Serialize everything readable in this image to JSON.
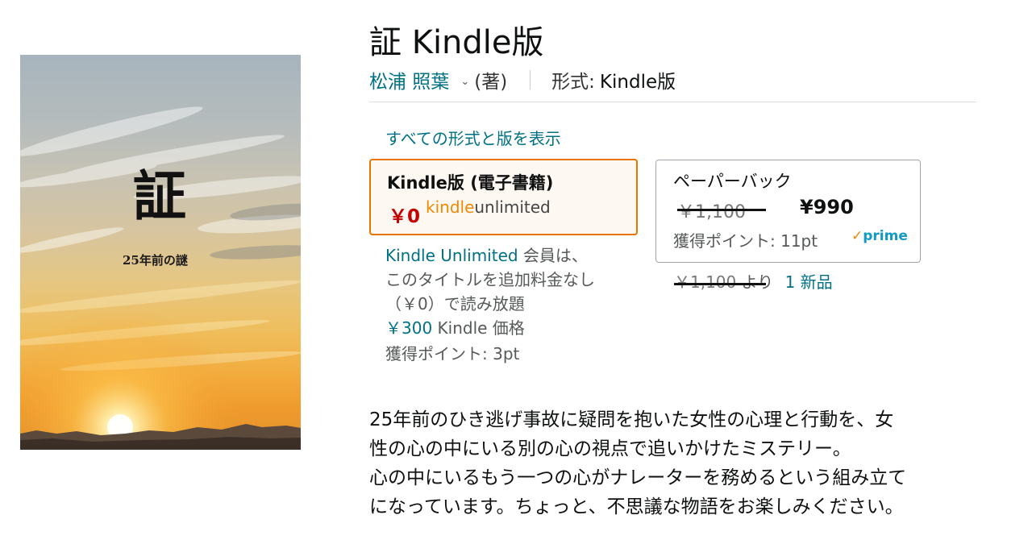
{
  "cover": {
    "title": "証",
    "subtitle": "25年前の謎"
  },
  "product": {
    "title": "証 Kindle版",
    "author": "松浦 照葉",
    "contribution": "(著)",
    "format_label": "形式:",
    "format_value": "Kindle版",
    "all_formats_link": "すべての形式と版を表示"
  },
  "formats": {
    "kindle": {
      "name": "Kindle版 (電子書籍)",
      "price": "￥0",
      "ku_logo_kindle": "kindle",
      "ku_logo_unlimited": "unlimited"
    },
    "paperback": {
      "name": "ペーパーバック",
      "list_price": "￥1,100",
      "sale_price": "¥990",
      "points": "獲得ポイント: 11pt",
      "prime_label": "prime",
      "new_from_price": "￥1,100",
      "new_from_text": "より",
      "new_from_link": "1 新品"
    }
  },
  "ku_info": {
    "link": "Kindle Unlimited",
    "line1_rest": " 会員は、",
    "line2": "このタイトルを追加料金なし",
    "line3": "（￥0）で読み放題",
    "kindle_price": "￥300",
    "kindle_price_label": " Kindle 価格",
    "points": "獲得ポイント: 3pt"
  },
  "description": {
    "line1": "25年前のひき逃げ事故に疑問を抱いた女性の心理と行動を、女",
    "line2": "性の心の中にいる別の心の視点で追いかけたミステリー。",
    "line3": "心の中にいるもう一つの心がナレーターを務めるという組み立て",
    "line4": "になっています。ちょっと、不思議な物語をお楽しみください。"
  },
  "colors": {
    "link": "#007185",
    "selected_border": "#e77600",
    "price_red": "#c40000",
    "prime_blue": "#1399c6",
    "ku_orange": "#f08804"
  },
  "icons": {
    "chevron": "chevron-down-icon",
    "prime_check": "prime-check-icon"
  }
}
